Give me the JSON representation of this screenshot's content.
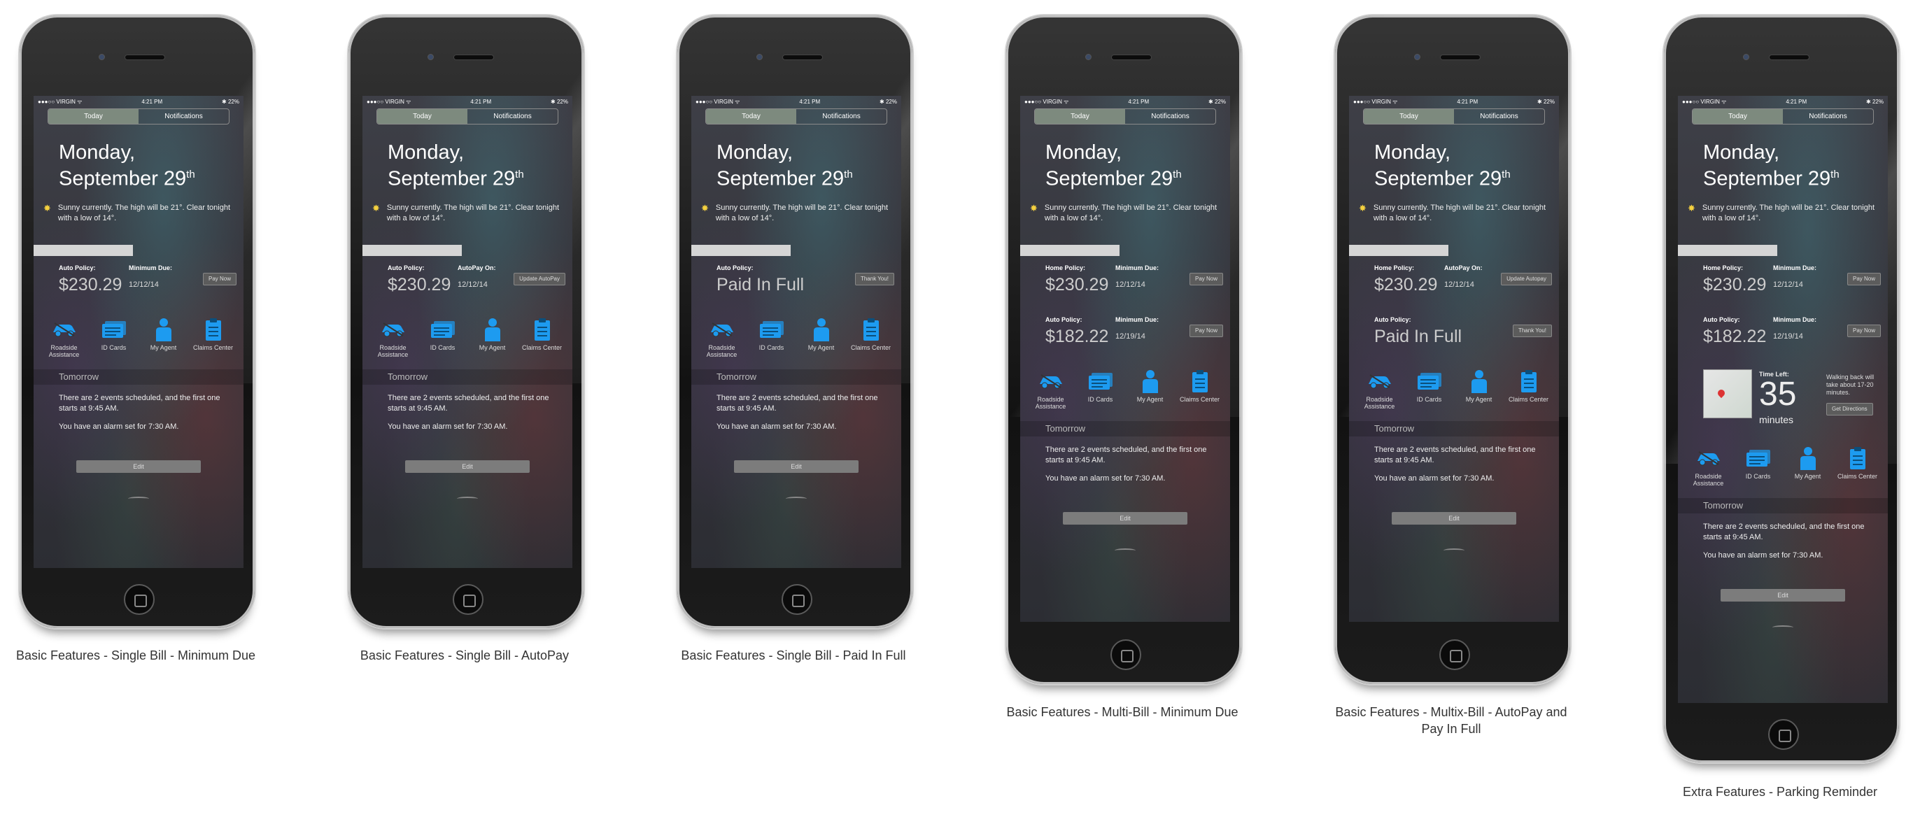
{
  "status": {
    "carrier": "●●●○○ VIRGIN ᯤ",
    "time": "4:21 PM",
    "battery": "✱ 22%"
  },
  "tabs": {
    "today": "Today",
    "notifications": "Notifications"
  },
  "date": {
    "line1": "Monday,",
    "line2": "September 29",
    "suffix": "th"
  },
  "weather": {
    "icon": "sun-icon",
    "text": "Sunny currently. The high will be 21°. Clear tonight with a low of 14°."
  },
  "features": [
    {
      "label": "Roadside Assistance",
      "icon": "car-icon"
    },
    {
      "label": "ID Cards",
      "icon": "id-cards-icon"
    },
    {
      "label": "My Agent",
      "icon": "person-icon"
    },
    {
      "label": "Claims Center",
      "icon": "clipboard-icon"
    }
  ],
  "tomorrow": {
    "heading": "Tomorrow",
    "events": "There are 2 events scheduled, and the first one starts at 9:45 AM.",
    "alarm": "You have an alarm set for 7:30 AM."
  },
  "edit_label": "Edit",
  "colors": {
    "accent": "#1d9bf0",
    "segment_active": "#7d8a7e"
  },
  "bills": {
    "m1": {
      "policy": "Auto Policy:",
      "label2": "Minimum Due:",
      "amount": "$230.29",
      "due": "12/12/14",
      "button": "Pay Now"
    },
    "m2": {
      "policy": "Auto Policy:",
      "label2": "AutoPay On:",
      "amount": "$230.29",
      "due": "12/12/14",
      "button": "Update AutoPay"
    },
    "m3": {
      "policy": "Auto Policy:",
      "label2": "",
      "amount": "Paid In Full",
      "due": "",
      "button": "Thank You!"
    },
    "m4a": {
      "policy": "Home Policy:",
      "label2": "Minimum Due:",
      "amount": "$230.29",
      "due": "12/12/14",
      "button": "Pay Now"
    },
    "m4b": {
      "policy": "Auto Policy:",
      "label2": "Minimum Due:",
      "amount": "$182.22",
      "due": "12/19/14",
      "button": "Pay Now"
    },
    "m5a": {
      "policy": "Home Policy:",
      "label2": "AutoPay On:",
      "amount": "$230.29",
      "due": "12/12/14",
      "button": "Update Autopay"
    },
    "m5b": {
      "policy": "Auto Policy:",
      "label2": "",
      "amount": "Paid In Full",
      "due": "",
      "button": "Thank You!"
    },
    "m6a": {
      "policy": "Home Policy:",
      "label2": "Minimum Due:",
      "amount": "$230.29",
      "due": "12/12/14",
      "button": "Pay Now"
    },
    "m6b": {
      "policy": "Auto Policy:",
      "label2": "Minimum Due:",
      "amount": "$182.22",
      "due": "12/19/14",
      "button": "Pay Now"
    }
  },
  "parking": {
    "time_left_label": "Time Left:",
    "minutes": "35",
    "minutes_label": "minutes",
    "walk_text": "Walking back will take about 17-20 minutes.",
    "button": "Get Directions"
  },
  "captions": {
    "c1": "Basic Features - Single Bill - Minimum Due",
    "c2": "Basic Features - Single Bill - AutoPay",
    "c3": "Basic Features - Single Bill - Paid In Full",
    "c4": "Basic Features - Multi-Bill - Minimum Due",
    "c5": "Basic Features - Multix-Bill - AutoPay and Pay In Full",
    "c6": "Extra Features - Parking Reminder"
  }
}
